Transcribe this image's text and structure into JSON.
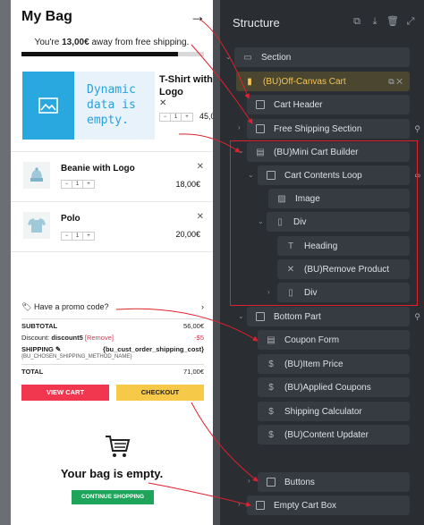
{
  "cart": {
    "title": "My Bag",
    "close_icon": "arrow-right-icon",
    "shipping_prefix": "You're ",
    "shipping_amount": "13,00€",
    "shipping_suffix": " away from free shipping.",
    "shipping_progress": 0.86,
    "item1": {
      "placeholder_text": "Dynamic data is empty.",
      "title": "T-Shirt with Logo",
      "qty": "1",
      "price": "45,0"
    },
    "items": [
      {
        "title": "Beanie with Logo",
        "qty": "1",
        "price": "18,00€",
        "icon": "beanie-icon"
      },
      {
        "title": "Polo",
        "qty": "1",
        "price": "20,00€",
        "icon": "polo-shirt-icon"
      }
    ],
    "promo_label": "Have a promo code?",
    "summary": {
      "subtotal_label": "SUBTOTAL",
      "subtotal_value": "56,00€",
      "discount_label": "Discount: ",
      "discount_code": "discount5",
      "remove_label": "[Remove]",
      "discount_value": "-$5",
      "shipping_label": "SHIPPING",
      "shipping_value": "{bu_cust_order_shipping_cost}",
      "shipping_method": "{BU_CHOSEN_SHIPPING_METHOD_NAME}",
      "total_label": "TOTAL",
      "total_value": "71,00€"
    },
    "view_cart_label": "VIEW CART",
    "checkout_label": "CHECKOUT",
    "empty_title": "Your bag is empty.",
    "continue_label": "CONTINUE SHOPPING",
    "colors": {
      "view_cart": "#f1364f",
      "checkout": "#f7c948",
      "continue": "#1fa55b",
      "placeholder": "#29a8e0"
    }
  },
  "structure": {
    "title": "Structure",
    "nodes": {
      "section": "Section",
      "offcanvas": "(BU)Off-Canvas Cart",
      "cart_header": "Cart Header",
      "free_shipping": "Free Shipping Section",
      "mini_cart": "(BU)Mini Cart Builder",
      "contents_loop": "Cart Contents Loop",
      "image": "Image",
      "div1": "Div",
      "heading": "Heading",
      "remove_product": "(BU)Remove Product",
      "div2": "Div",
      "bottom_part": "Bottom Part",
      "coupon_form": "Coupon Form",
      "item_price": "(BU)Item Price",
      "applied_coupons": "(BU)Applied Coupons",
      "shipping_calc": "Shipping Calculator",
      "content_updater": "(BU)Content Updater",
      "buttons": "Buttons",
      "empty_cart": "Empty Cart Box"
    },
    "accent": "#f5c451",
    "highlight": "#e0202e"
  }
}
